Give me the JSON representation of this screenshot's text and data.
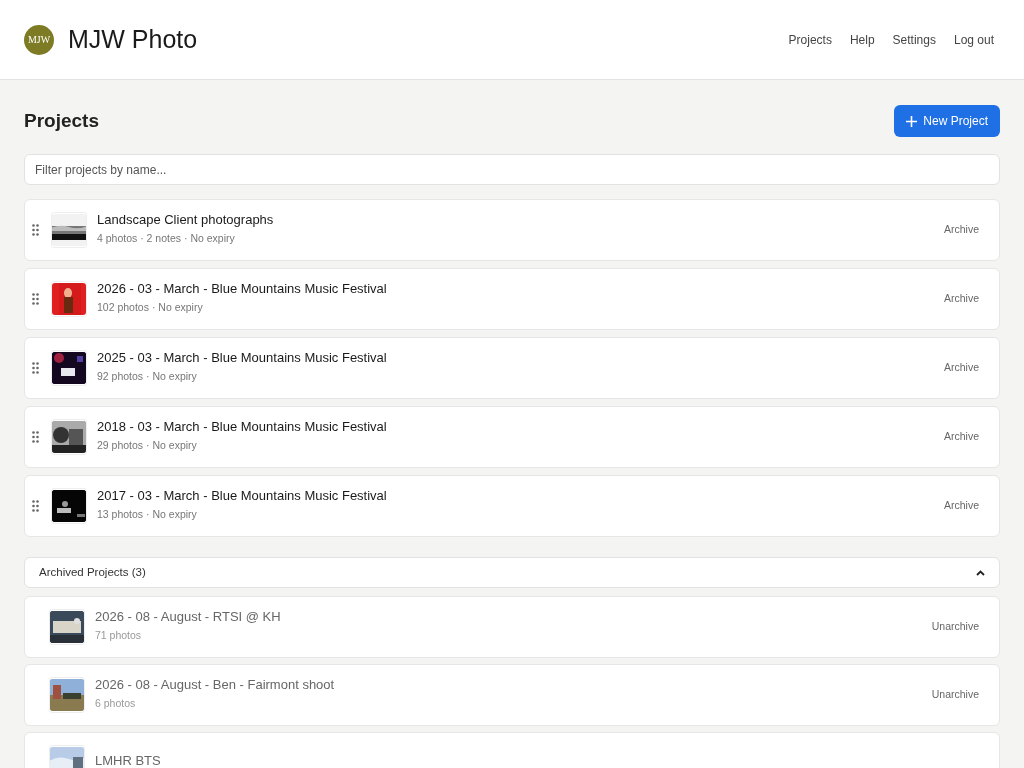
{
  "header": {
    "logo": "MJW",
    "title": "MJW Photo",
    "nav": [
      "Projects",
      "Help",
      "Settings",
      "Log out"
    ]
  },
  "page": {
    "title": "Projects",
    "new_button": "New Project",
    "filter": {
      "placeholder": "Filter projects by name..."
    }
  },
  "projects": [
    {
      "name": "Landscape Client photographs",
      "meta": "4 photos · 2 notes · No expiry",
      "action": "Archive"
    },
    {
      "name": "2026 - 03 - March - Blue Mountains Music Festival",
      "meta": "102 photos · No expiry",
      "action": "Archive"
    },
    {
      "name": "2025 - 03 - March - Blue Mountains Music Festival",
      "meta": "92 photos · No expiry",
      "action": "Archive"
    },
    {
      "name": "2018 - 03 - March - Blue Mountains Music Festival",
      "meta": "29 photos · No expiry",
      "action": "Archive"
    },
    {
      "name": "2017 - 03 - March - Blue Mountains Music Festival",
      "meta": "13 photos · No expiry",
      "action": "Archive"
    }
  ],
  "archived": {
    "title": "Archived Projects (3)",
    "expanded": true,
    "projects": [
      {
        "name": "2026 - 08 - August - RTSI @ KH",
        "meta": "71 photos",
        "action": "Unarchive"
      },
      {
        "name": "2026 - 08 - August - Ben - Fairmont shoot",
        "meta": "6 photos",
        "action": "Unarchive"
      },
      {
        "name": "LMHR BTS"
      }
    ]
  }
}
